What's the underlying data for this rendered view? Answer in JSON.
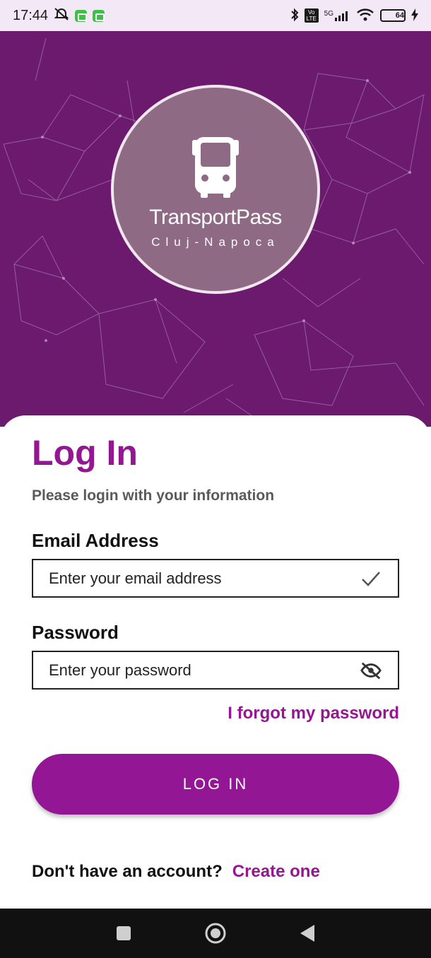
{
  "status_bar": {
    "time": "17:44",
    "network": "5G",
    "volte": "Vo LTE",
    "battery_percent": "64",
    "battery_level": 0.64,
    "icons": [
      "alarm-off-icon",
      "app-notification-icon",
      "app-notification-icon",
      "bluetooth-icon",
      "volte-icon",
      "signal-icon",
      "wifi-icon",
      "battery-icon",
      "charging-icon"
    ]
  },
  "hero": {
    "background_color": "#6b1a6e",
    "logo": {
      "title": "TransportPass",
      "subtitle": "Cluj-Napoca",
      "icon": "bus-icon"
    }
  },
  "login": {
    "title": "Log In",
    "subtitle": "Please login with your information",
    "email": {
      "label": "Email Address",
      "placeholder": "Enter your email address",
      "value": "",
      "icon": "check-icon"
    },
    "password": {
      "label": "Password",
      "placeholder": "Enter your password",
      "value": "",
      "icon": "visibility-off-icon"
    },
    "forgot_label": "I forgot my password",
    "submit_label": "LOG IN",
    "signup_prompt": "Don't have an account?",
    "signup_link": "Create one",
    "accent_color": "#921791"
  },
  "nav_bar": {
    "buttons": [
      "recents-button",
      "home-button",
      "back-button"
    ]
  }
}
